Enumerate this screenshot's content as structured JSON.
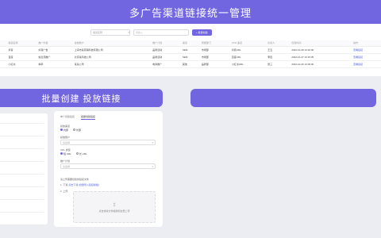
{
  "header": {
    "title": "多广告渠道链接统一管理"
  },
  "search": {
    "select_placeholder": "渠道名称",
    "input_placeholder": "请输入",
    "button_label": "+ 批量创建"
  },
  "table": {
    "columns": [
      "",
      "渠道名称",
      "推广内容",
      "投放账户",
      "推广计划",
      "渠道",
      "所属部门",
      "UTM 渠道",
      "负责人",
      "创建时间",
      "操作"
    ],
    "rows": [
      [
        "",
        "抖音",
        "抖音广告",
        "上海市某营销科技有限公司",
        "品牌活动",
        "SEM",
        "市场部",
        "抖音URL",
        "王五",
        "2022-10-28 10:40:00",
        "查看链接"
      ],
      [
        "",
        "百度",
        "信息流推广",
        "北京某科技公司",
        "品牌活动",
        "SEM",
        "市场部",
        "百度URL",
        "李四",
        "2022-10-27 10:15:35",
        "查看链接"
      ],
      [
        "",
        "小红书",
        "种草",
        "某某公司",
        "电商推广",
        "其他",
        "品牌部",
        "小红书URL",
        "张三",
        "2022-10-26 10:09:00",
        "查看链接"
      ]
    ]
  },
  "left_banner": {
    "title": "批量创建 投放链接"
  },
  "dialog": {
    "tabs": [
      "单个创建链接",
      "批量创建链接"
    ],
    "channel_label": "投放渠道",
    "channel_options": [
      "内部",
      "外部"
    ],
    "account_label": "投放账户",
    "account_placeholder": "请选择",
    "url_label": "URL 类型",
    "url_options": [
      "短 URL",
      "长 URL"
    ],
    "plan_label": "推广计划",
    "plan_placeholder": "请选择",
    "upload_label": "请上传需要创建的链接文件",
    "download_prefix": "1. 下载",
    "template_link": "点击下载 (批量导入链接模板)",
    "upload_step": "2. 上传",
    "upload_hint": "点击或将文件拖拽到这里上传"
  },
  "colors": {
    "accent": "#7266e0",
    "link": "#4a5ee0"
  }
}
